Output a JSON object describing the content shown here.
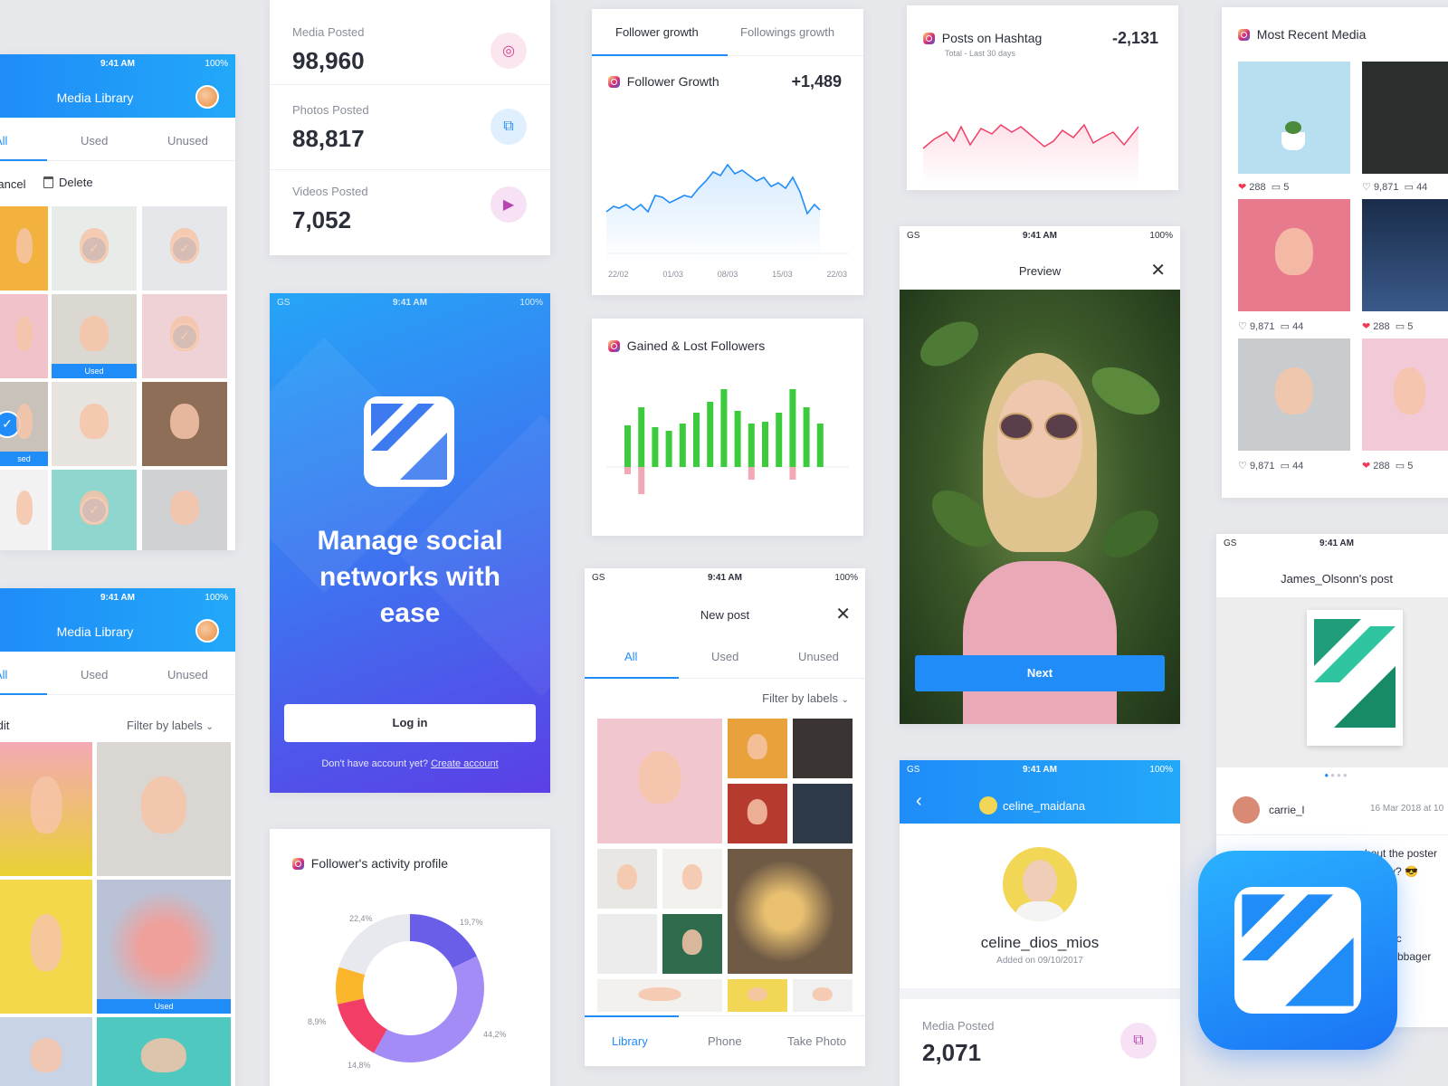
{
  "media_library_1": {
    "status_time": "9:41 AM",
    "battery": "100%",
    "title": "Media Library",
    "tabs": [
      "All",
      "Used",
      "Unused"
    ],
    "cancel": "Cancel",
    "delete": "Delete",
    "used_badge": "Used"
  },
  "media_library_2": {
    "status_time": "9:41 AM",
    "battery": "100%",
    "title": "Media Library",
    "tabs": [
      "All",
      "Used",
      "Unused"
    ],
    "edit": "Edit",
    "filter": "Filter by labels",
    "used_badge": "Used"
  },
  "stats": [
    {
      "label": "Media Posted",
      "value": "98,960",
      "icon": "instagram-icon"
    },
    {
      "label": "Photos Posted",
      "value": "88,817",
      "icon": "photos-icon"
    },
    {
      "label": "Videos Posted",
      "value": "7,052",
      "icon": "play-icon"
    }
  ],
  "login": {
    "carrier": "GS",
    "status_time": "9:41 AM",
    "battery": "100%",
    "headline": "Manage social networks with ease",
    "login_button": "Log in",
    "no_account": "Don't have account yet?",
    "create_account": "Create account"
  },
  "activity": {
    "title": "Follower's activity profile",
    "slices": [
      {
        "label": "19,7%",
        "value": 19.7,
        "color": "#6a5ee8"
      },
      {
        "label": "44,2%",
        "value": 44.2,
        "color": "#a48cf7"
      },
      {
        "label": "14,8%",
        "value": 14.8,
        "color": "#f23d66"
      },
      {
        "label": "8,9%",
        "value": 8.9,
        "color": "#fbb62b"
      },
      {
        "label": "22,4%",
        "value": 22.4,
        "color": "#e8e9ee"
      }
    ]
  },
  "growth": {
    "tabs": [
      "Follower growth",
      "Followings growth"
    ],
    "title": "Follower Growth",
    "value": "+1,489",
    "dates": [
      "22/02",
      "01/03",
      "08/03",
      "15/03",
      "22/03"
    ]
  },
  "gained_lost": {
    "title": "Gained & Lost Followers"
  },
  "new_post": {
    "carrier": "GS",
    "status_time": "9:41 AM",
    "battery": "100%",
    "title": "New post",
    "tabs": [
      "All",
      "Used",
      "Unused"
    ],
    "filter": "Filter by labels",
    "bottom_tabs": [
      "Library",
      "Phone",
      "Take Photo"
    ]
  },
  "hashtag": {
    "title": "Posts on Hashtag",
    "subtitle": "Total - Last 30 days",
    "value": "-2,131"
  },
  "preview": {
    "carrier": "GS",
    "status_time": "9:41 AM",
    "battery": "100%",
    "title": "Preview",
    "next": "Next"
  },
  "profile": {
    "carrier": "GS",
    "status_time": "9:41 AM",
    "battery": "100%",
    "header_user": "celine_maidana",
    "name": "celine_dios_mios",
    "added": "Added on 09/10/2017",
    "stat_label": "Media Posted",
    "stat_value": "2,071"
  },
  "recent": {
    "title": "Most Recent Media",
    "items": [
      {
        "likes": "288",
        "comments": "5",
        "liked": true
      },
      {
        "likes": "9,871",
        "comments": "44",
        "liked": false
      },
      {
        "likes": "9,871",
        "comments": "44",
        "liked": false
      },
      {
        "likes": "288",
        "comments": "5",
        "liked": true
      },
      {
        "likes": "9,871",
        "comments": "44",
        "liked": false
      },
      {
        "likes": "288",
        "comments": "5",
        "liked": true
      }
    ]
  },
  "post": {
    "carrier": "GS",
    "status_time": "9:41 AM",
    "title": "James_Olsonn's post",
    "commenter": "carrie_l",
    "date": "16 Mar 2018 at 10",
    "comment1": "bout the poster",
    "comment2": "sy? 😎",
    "comment3": "ic",
    "comment4": "r #bbager"
  },
  "colors": {
    "accent": "#1f8cf8",
    "gain": "#3ccb3c",
    "loss": "#f2a9b5",
    "brand": "#4b58e8"
  }
}
